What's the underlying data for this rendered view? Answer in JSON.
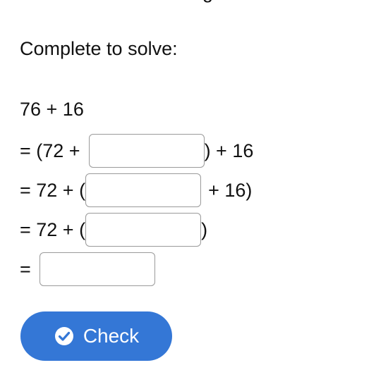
{
  "heading_fragment": "g",
  "instruction": "Complete to solve:",
  "equation": {
    "line1": "76 + 16",
    "line2": {
      "prefix": "= (72 +",
      "suffix": ") + 16",
      "value": ""
    },
    "line3": {
      "prefix": "= 72 + (",
      "suffix": "+ 16)",
      "value": ""
    },
    "line4": {
      "prefix": "= 72 + (",
      "suffix": ")",
      "value": ""
    },
    "line5": {
      "prefix": "=",
      "value": ""
    }
  },
  "check_button": {
    "label": "Check",
    "icon": "check-circle-icon",
    "color": "#3477d6"
  }
}
